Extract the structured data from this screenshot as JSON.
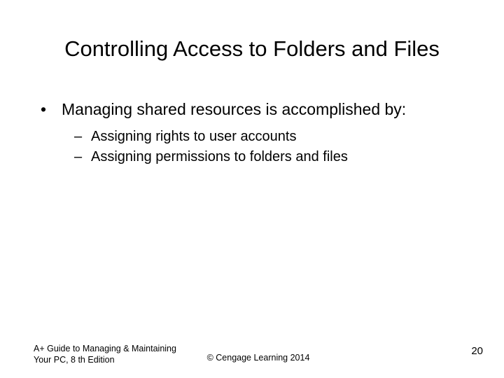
{
  "title": "Controlling Access to Folders and Files",
  "bullets": {
    "b1": "Managing shared resources is accomplished by:",
    "sub1": "Assigning rights to user accounts",
    "sub2": "Assigning permissions to folders and files"
  },
  "footer": {
    "left_line1": "A+ Guide to Managing & Maintaining",
    "left_line2": "Your PC, 8 th Edition",
    "center": "©  Cengage Learning 2014",
    "page": "20"
  }
}
